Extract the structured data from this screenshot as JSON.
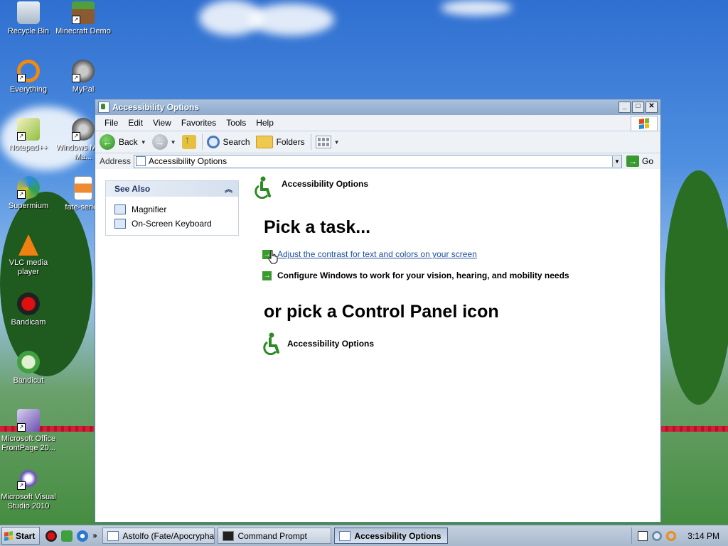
{
  "desktop": {
    "icons": [
      {
        "label": "Recycle Bin"
      },
      {
        "label": "Minecraft Demo"
      },
      {
        "label": "Everything"
      },
      {
        "label": "MyPal"
      },
      {
        "label": "Notepad++"
      },
      {
        "label": "Windows Movie Ma..."
      },
      {
        "label": "Supermium"
      },
      {
        "label": "fate-series"
      },
      {
        "label": "VLC media player"
      },
      {
        "label": "Bandicam"
      },
      {
        "label": "Bandicut"
      },
      {
        "label": "Microsoft Office FrontPage 20..."
      },
      {
        "label": "Microsoft Visual Studio 2010"
      }
    ]
  },
  "window": {
    "title": "Accessibility Options",
    "menu": [
      "File",
      "Edit",
      "View",
      "Favorites",
      "Tools",
      "Help"
    ],
    "toolbar": {
      "back": "Back",
      "search": "Search",
      "folders": "Folders"
    },
    "address": {
      "label": "Address",
      "value": "Accessibility Options",
      "go": "Go"
    },
    "see_also": {
      "title": "See Also",
      "items": [
        "Magnifier",
        "On-Screen Keyboard"
      ]
    },
    "main": {
      "header": "Accessibility Options",
      "pick_task": "Pick a task...",
      "tasks": [
        "Adjust the contrast for text and colors on your screen",
        "Configure Windows to work for your vision, hearing, and mobility needs"
      ],
      "or_pick": "or pick a Control Panel icon",
      "cp_icon_label": "Accessibility Options"
    }
  },
  "taskbar": {
    "start": "Start",
    "quick_launch_more": "»",
    "buttons": [
      {
        "label": "Astolfo (Fate/Apocrypha),..."
      },
      {
        "label": "Command Prompt"
      },
      {
        "label": "Accessibility Options"
      }
    ],
    "clock": "3:14 PM"
  },
  "colors": {
    "accent_green": "#3a9a30",
    "link_blue": "#1e4fa0",
    "title_blue": "#8fabcc"
  }
}
